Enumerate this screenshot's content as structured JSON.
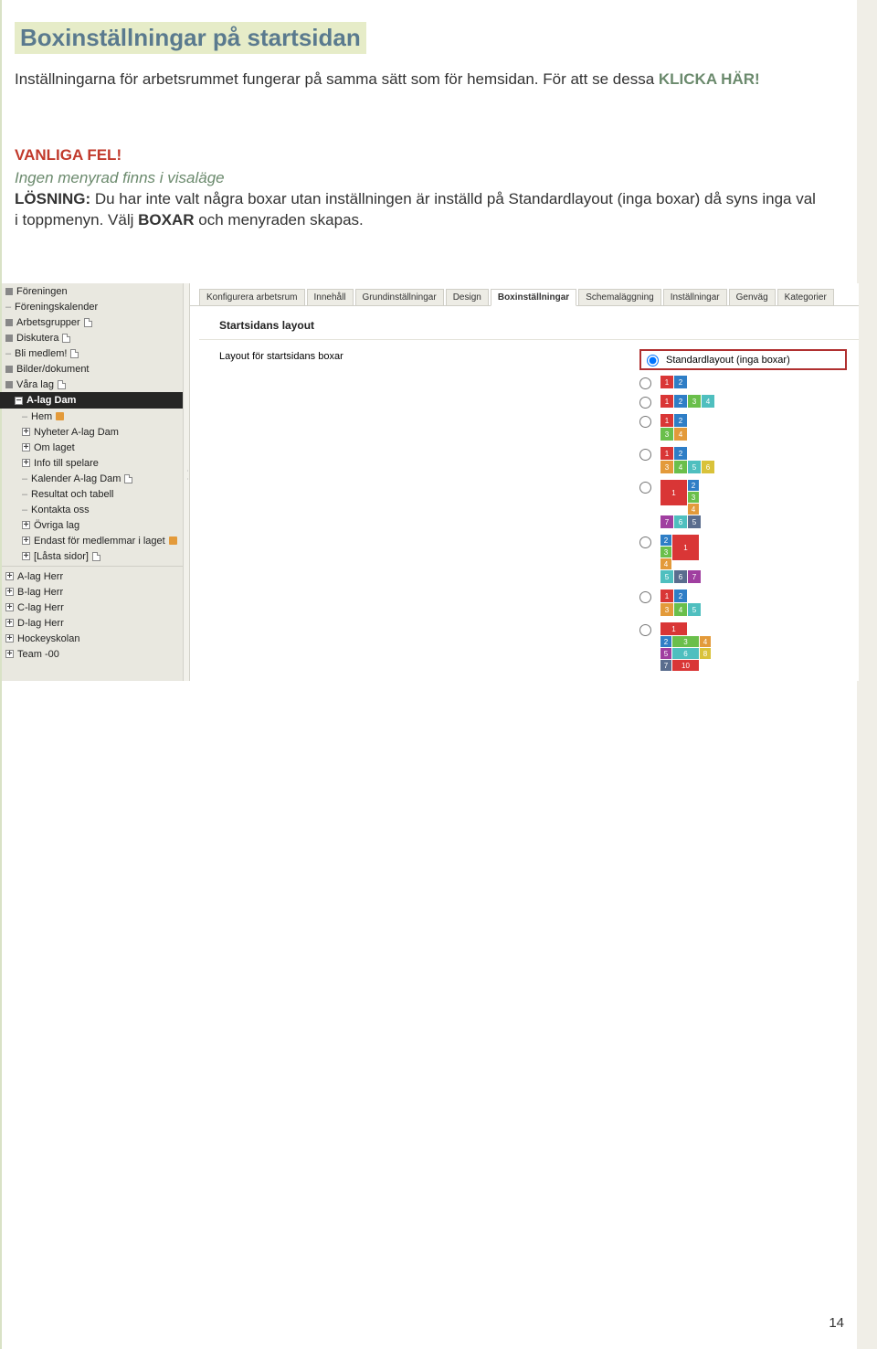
{
  "page_number": "14",
  "heading": "Boxinställningar på startsidan",
  "intro_text": "Inställningarna för arbetsrummet fungerar på samma sätt som för hemsidan. För att se dessa ",
  "klicka": "KLICKA HÄR!",
  "vanliga_fel": "VANLIGA FEL!",
  "hint_italic": "Ingen menyrad finns i visaläge",
  "losning_label": "LÖSNING: ",
  "losning_text_1": "Du har inte valt några boxar utan inställningen är inställd på Standardlayout (inga boxar) då syns inga val i toppmenyn. Välj ",
  "boxar_word": "BOXAR",
  "losning_text_2": " och menyraden skapas.",
  "sidebar": {
    "items": [
      {
        "label": "Föreningen",
        "kind": "filled"
      },
      {
        "label": "Föreningskalender",
        "kind": "dash"
      },
      {
        "label": "Arbetsgrupper",
        "kind": "filled",
        "doc": true
      },
      {
        "label": "Diskutera",
        "kind": "filled",
        "doc": true
      },
      {
        "label": "Bli medlem!",
        "kind": "dash",
        "doc": true
      },
      {
        "label": "Bilder/dokument",
        "kind": "filled"
      },
      {
        "label": "Våra lag",
        "kind": "filled",
        "doc": true
      },
      {
        "label": "A-lag Dam",
        "kind": "selected"
      },
      {
        "label": "Hem",
        "kind": "dash",
        "flag": true,
        "indent": true
      },
      {
        "label": "Nyheter A-lag Dam",
        "kind": "plus",
        "indent": true
      },
      {
        "label": "Om laget",
        "kind": "plus",
        "indent": true
      },
      {
        "label": "Info till spelare",
        "kind": "plus",
        "indent": true
      },
      {
        "label": "Kalender A-lag Dam",
        "kind": "dash",
        "doc": true,
        "indent": true
      },
      {
        "label": "Resultat och tabell",
        "kind": "dash",
        "indent": true
      },
      {
        "label": "Kontakta oss",
        "kind": "dash",
        "indent": true
      },
      {
        "label": "Övriga lag",
        "kind": "plus",
        "indent": true
      },
      {
        "label": "Endast för medlemmar i laget",
        "kind": "plus",
        "flag": true,
        "indent": true
      },
      {
        "label": "[Låsta sidor]",
        "kind": "plus",
        "doc": true,
        "indent": true
      },
      {
        "label": "A-lag Herr",
        "kind": "plus"
      },
      {
        "label": "B-lag Herr",
        "kind": "plus"
      },
      {
        "label": "C-lag Herr",
        "kind": "plus"
      },
      {
        "label": "D-lag Herr",
        "kind": "plus"
      },
      {
        "label": "Hockeyskolan",
        "kind": "plus"
      },
      {
        "label": "Team -00",
        "kind": "plus"
      }
    ]
  },
  "tabs": [
    "Konfigurera arbetsrum",
    "Innehåll",
    "Grundinställningar",
    "Design",
    "Boxinställningar",
    "Schemaläggning",
    "Inställningar",
    "Genväg",
    "Kategorier"
  ],
  "active_tab_index": 4,
  "section_title": "Startsidans layout",
  "form_label": "Layout för startsidans boxar",
  "option_selected": "Standardlayout (inga boxar)"
}
